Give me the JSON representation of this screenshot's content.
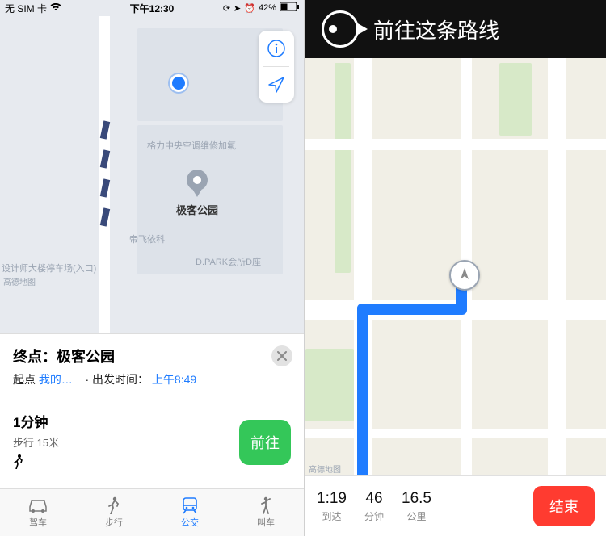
{
  "left": {
    "statusbar": {
      "carrier": "无 SIM 卡",
      "time": "下午12:30",
      "battery_pct": "42%"
    },
    "map": {
      "poi_main": "极客公园",
      "labels": {
        "l1": "格力中央空调维修加氟",
        "l2": "帝飞依科",
        "l3": "D.PARK会所D座",
        "l4": "设计师大楼停车场(入口)"
      },
      "attribution": "高德地图"
    },
    "sheet": {
      "dest_prefix": "终点：",
      "dest_name": "极客公园",
      "origin_label": "起点",
      "origin_value": "我的…",
      "depart_label": "· 出发时间：",
      "depart_value": "上午8:49",
      "duration": "1分钟",
      "distance": "步行 15米",
      "go_label": "前往"
    },
    "tabs": [
      {
        "id": "drive",
        "label": "驾车"
      },
      {
        "id": "walk",
        "label": "步行"
      },
      {
        "id": "transit",
        "label": "公交",
        "active": true
      },
      {
        "id": "ride",
        "label": "叫车"
      }
    ]
  },
  "right": {
    "banner": "前往这条路线",
    "map": {
      "attribution": "高德地图"
    },
    "nav": {
      "arrival_value": "1:19",
      "arrival_label": "到达",
      "minutes_value": "46",
      "minutes_label": "分钟",
      "distance_value": "16.5",
      "distance_label": "公里",
      "end_label": "结束"
    }
  }
}
